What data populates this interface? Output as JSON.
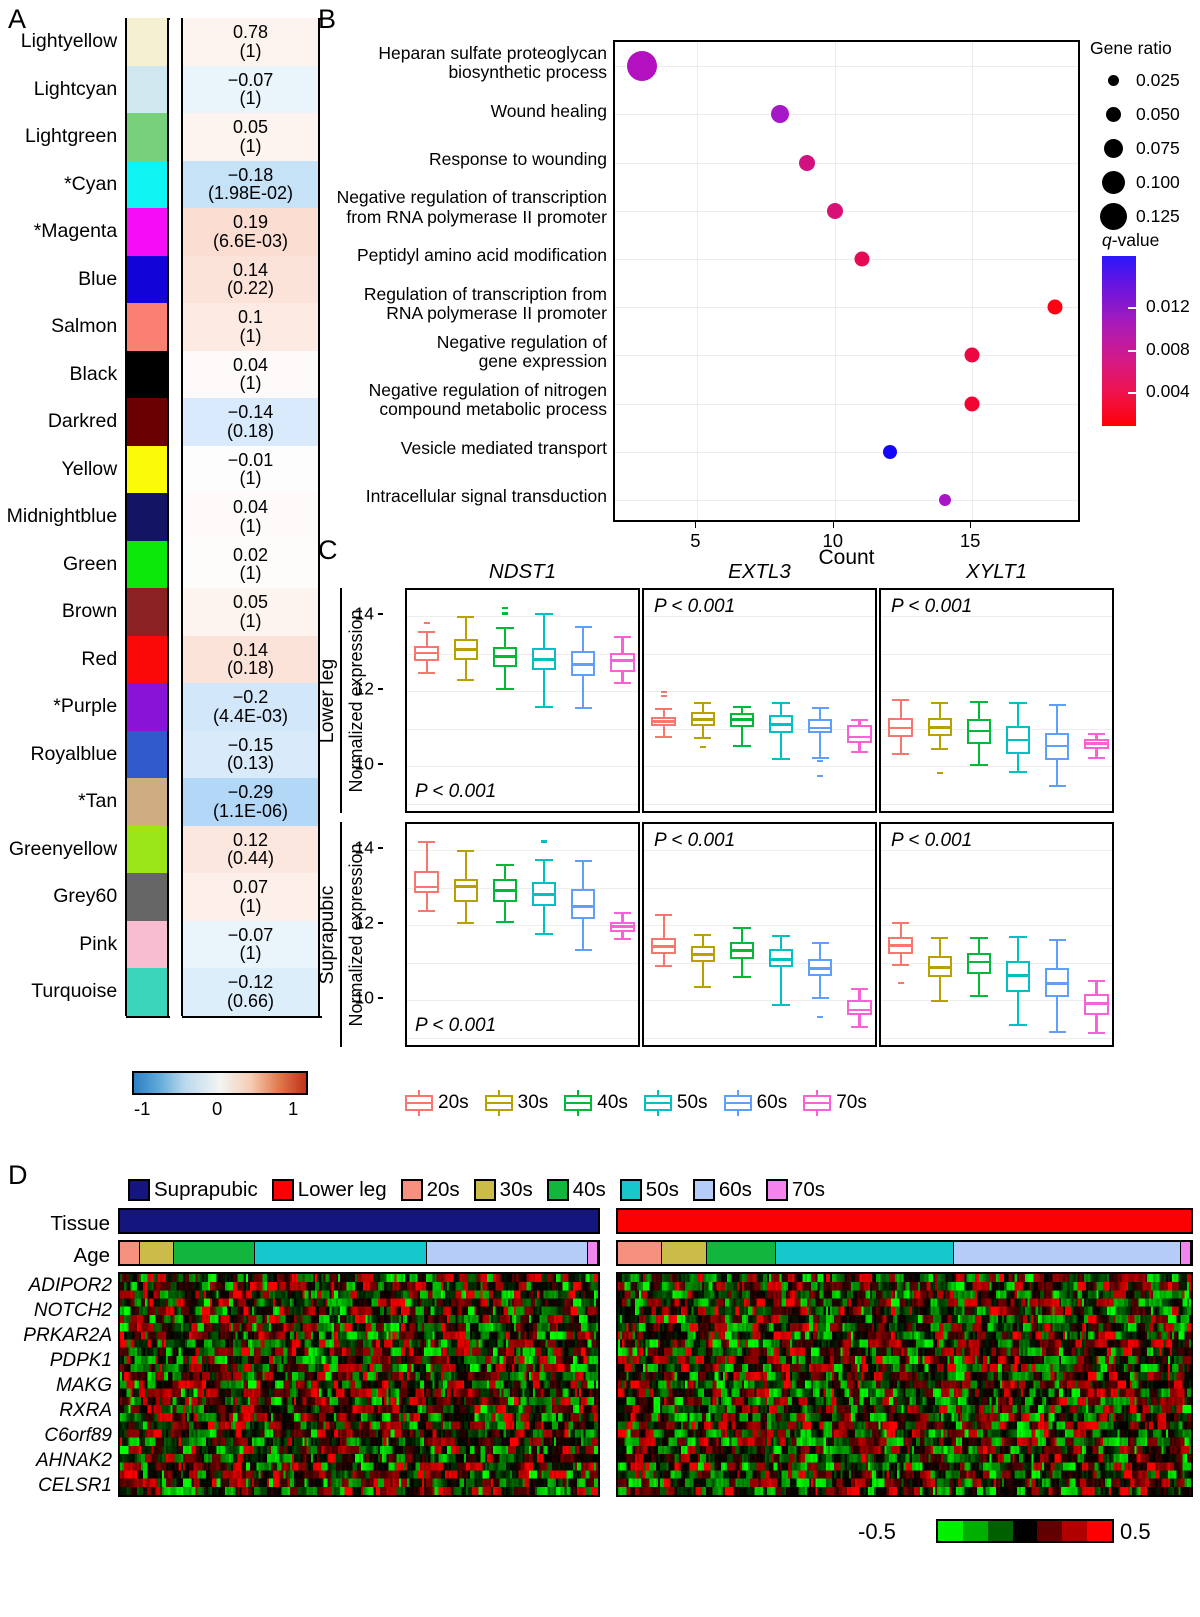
{
  "panels": {
    "A": {
      "letter": "A"
    },
    "B": {
      "letter": "B"
    },
    "C": {
      "letter": "C"
    },
    "D": {
      "letter": "D"
    }
  },
  "panelA": {
    "scale": {
      "min": "-1",
      "mid": "0",
      "max": "1"
    },
    "rows": [
      {
        "name": "Lightyellow",
        "color": "#f5f0d2",
        "corr": "0.78",
        "p": "(1)",
        "cell": "#fdf3ee"
      },
      {
        "name": "Lightcyan",
        "color": "#cfe8f0",
        "corr": "−0.07",
        "p": "(1)",
        "cell": "#eaf4fb"
      },
      {
        "name": "Lightgreen",
        "color": "#77d17a",
        "corr": "0.05",
        "p": "(1)",
        "cell": "#fdf4ef"
      },
      {
        "name": "*Cyan",
        "color": "#10f3f3",
        "corr": "−0.18",
        "p": "(1.98E-02)",
        "cell": "#c6e2f7"
      },
      {
        "name": "*Magenta",
        "color": "#f50ef5",
        "corr": "0.19",
        "p": "(6.6E-03)",
        "cell": "#fbddd2"
      },
      {
        "name": "Blue",
        "color": "#1204d8",
        "corr": "0.14",
        "p": "(0.22)",
        "cell": "#fce3da"
      },
      {
        "name": "Salmon",
        "color": "#fa8072",
        "corr": "0.1",
        "p": "(1)",
        "cell": "#fdeae3"
      },
      {
        "name": "Black",
        "color": "#000000",
        "corr": "0.04",
        "p": "(1)",
        "cell": "#fefafa"
      },
      {
        "name": "Darkred",
        "color": "#6b0000",
        "corr": "−0.14",
        "p": "(0.18)",
        "cell": "#d8eafb"
      },
      {
        "name": "Yellow",
        "color": "#fbfb09",
        "corr": "−0.01",
        "p": "(1)",
        "cell": "#fdfdfd"
      },
      {
        "name": "Midnightblue",
        "color": "#141464",
        "corr": "0.04",
        "p": "(1)",
        "cell": "#fefafa"
      },
      {
        "name": "Green",
        "color": "#09e809",
        "corr": "0.02",
        "p": "(1)",
        "cell": "#fefcfb"
      },
      {
        "name": "Brown",
        "color": "#8b2121",
        "corr": "0.05",
        "p": "(1)",
        "cell": "#fdf4ef"
      },
      {
        "name": "Red",
        "color": "#fb0808",
        "corr": "0.14",
        "p": "(0.18)",
        "cell": "#fce3da"
      },
      {
        "name": "*Purple",
        "color": "#8a13d8",
        "corr": "−0.2",
        "p": "(4.4E-03)",
        "cell": "#d3e7fa"
      },
      {
        "name": "Royalblue",
        "color": "#3059cb",
        "corr": "−0.15",
        "p": "(0.13)",
        "cell": "#d9ebfb"
      },
      {
        "name": "*Tan",
        "color": "#cfad80",
        "corr": "−0.29",
        "p": "(1.1E-06)",
        "cell": "#b3d7f6"
      },
      {
        "name": "Greenyellow",
        "color": "#9ae619",
        "corr": "0.12",
        "p": "(0.44)",
        "cell": "#fce7df"
      },
      {
        "name": "Grey60",
        "color": "#666666",
        "corr": "0.07",
        "p": "(1)",
        "cell": "#fdf0ea"
      },
      {
        "name": "Pink",
        "color": "#f9bdd2",
        "corr": "−0.07",
        "p": "(1)",
        "cell": "#eaf4fb"
      },
      {
        "name": "Turquoise",
        "color": "#3bd5bb",
        "corr": "−0.12",
        "p": "(0.66)",
        "cell": "#ddeefb"
      }
    ]
  },
  "chart_data": [
    {
      "type": "scatter",
      "panel": "B",
      "title": "",
      "xlabel": "Count",
      "ylabel": "",
      "xlim": [
        2,
        19
      ],
      "xticks": [
        5,
        10,
        15
      ],
      "xtick_labels": [
        "5",
        "10",
        "15"
      ],
      "grid": true,
      "legend_position": "right",
      "size_legend": {
        "title": "Gene ratio",
        "values": [
          "0.025",
          "0.050",
          "0.075",
          "0.100",
          "0.125"
        ]
      },
      "color_legend": {
        "title": "q-value",
        "ticks": [
          "0.012",
          "0.008",
          "0.004"
        ],
        "low_color": "#fe0008",
        "high_color": "#2b16fb"
      },
      "categories": [
        "Heparan sulfate proteoglycan biosynthetic process",
        "Wound healing",
        "Response to wounding",
        "Negative regulation of transcription from RNA polymerase II promoter",
        "Peptidyl amino acid modification",
        "Regulation of transcription from RNA polymerase II promoter",
        "Negative regulation of gene expression",
        "Negative regulation of nitrogen compound metabolic process",
        "Vesicle mediated transport",
        "Intracellular signal transduction"
      ],
      "points": [
        {
          "label": "Heparan sulfate proteoglycan biosynthetic process",
          "count": 3,
          "gene_ratio": 0.125,
          "q": 0.0095,
          "color": "#b311c0",
          "size": 30
        },
        {
          "label": "Wound healing",
          "count": 8,
          "gene_ratio": 0.048,
          "q": 0.009,
          "color": "#a617c9",
          "size": 18
        },
        {
          "label": "Response to wounding",
          "count": 9,
          "gene_ratio": 0.04,
          "q": 0.0062,
          "color": "#d1117f",
          "size": 16
        },
        {
          "label": "Negative regulation of transcription from RNA polymerase II promoter",
          "count": 10,
          "gene_ratio": 0.04,
          "q": 0.0058,
          "color": "#d80f74",
          "size": 16
        },
        {
          "label": "Peptidyl amino acid modification",
          "count": 11,
          "gene_ratio": 0.038,
          "q": 0.0045,
          "color": "#e60a53",
          "size": 15
        },
        {
          "label": "Regulation of transcription from RNA polymerase II promoter",
          "count": 18,
          "gene_ratio": 0.036,
          "q": 0.002,
          "color": "#fd0210",
          "size": 15
        },
        {
          "label": "Negative regulation of gene expression",
          "count": 15,
          "gene_ratio": 0.036,
          "q": 0.0038,
          "color": "#ec0741",
          "size": 15
        },
        {
          "label": "Negative regulation of nitrogen compound metabolic process",
          "count": 15,
          "gene_ratio": 0.036,
          "q": 0.0032,
          "color": "#f20531",
          "size": 15
        },
        {
          "label": "Vesicle mediated transport",
          "count": 12,
          "gene_ratio": 0.032,
          "q": 0.015,
          "color": "#1606f7",
          "size": 14
        },
        {
          "label": "Intracellular signal transduction",
          "count": 14,
          "gene_ratio": 0.028,
          "q": 0.0105,
          "color": "#a915c6",
          "size": 12
        }
      ]
    },
    {
      "type": "box",
      "panel": "C",
      "ylabel": "Normalized expression",
      "ylim": [
        8.7,
        14.7
      ],
      "yticks": [
        10,
        12,
        14
      ],
      "ytick_labels": [
        "10",
        "12",
        "14"
      ],
      "genes": [
        "NDST1",
        "EXTL3",
        "XYLT1"
      ],
      "tissues": [
        "Lower leg",
        "Suprapubic"
      ],
      "groups": [
        "20s",
        "30s",
        "40s",
        "50s",
        "60s",
        "70s"
      ],
      "group_colors": [
        "#f7766d",
        "#b8a000",
        "#00b939",
        "#00c1c1",
        "#5f9efa",
        "#fb61d7"
      ],
      "p_values": {
        "Lower leg": {
          "NDST1": "P < 0.001",
          "EXTL3": "P < 0.001",
          "XYLT1": "P < 0.001"
        },
        "Suprapubic": {
          "NDST1": "P < 0.001",
          "EXTL3": "P < 0.001",
          "XYLT1": "P < 0.001"
        }
      },
      "boxes": {
        "Lower leg": {
          "NDST1": [
            {
              "group": "20s",
              "low": 12.52,
              "q1": 12.82,
              "med": 13.02,
              "q3": 13.22,
              "high": 13.62,
              "outliers": [
                13.82
              ]
            },
            {
              "group": "30s",
              "low": 12.32,
              "q1": 12.84,
              "med": 13.12,
              "q3": 13.4,
              "high": 14.0,
              "outliers": []
            },
            {
              "group": "40s",
              "low": 12.1,
              "q1": 12.66,
              "med": 12.92,
              "q3": 13.18,
              "high": 13.72,
              "outliers": [
                14.08,
                14.22
              ]
            },
            {
              "group": "50s",
              "low": 11.62,
              "q1": 12.56,
              "med": 12.84,
              "q3": 13.16,
              "high": 14.08,
              "outliers": []
            },
            {
              "group": "60s",
              "low": 11.58,
              "q1": 12.4,
              "med": 12.72,
              "q3": 13.08,
              "high": 13.74,
              "outliers": []
            },
            {
              "group": "70s",
              "low": 12.24,
              "q1": 12.52,
              "med": 12.82,
              "q3": 13.02,
              "high": 13.48,
              "outliers": []
            }
          ],
          "EXTL3": [
            {
              "group": "20s",
              "low": 10.82,
              "q1": 11.08,
              "med": 11.2,
              "q3": 11.32,
              "high": 11.56,
              "outliers": [
                11.88,
                11.98
              ]
            },
            {
              "group": "30s",
              "low": 10.78,
              "q1": 11.08,
              "med": 11.24,
              "q3": 11.46,
              "high": 11.72,
              "outliers": [
                10.52
              ]
            },
            {
              "group": "40s",
              "low": 10.56,
              "q1": 11.04,
              "med": 11.24,
              "q3": 11.42,
              "high": 11.62,
              "outliers": []
            },
            {
              "group": "50s",
              "low": 10.22,
              "q1": 10.9,
              "med": 11.12,
              "q3": 11.36,
              "high": 11.72,
              "outliers": []
            },
            {
              "group": "60s",
              "low": 10.26,
              "q1": 10.88,
              "med": 11.02,
              "q3": 11.26,
              "high": 11.58,
              "outliers": [
                10.14,
                9.74
              ]
            },
            {
              "group": "70s",
              "low": 10.4,
              "q1": 10.62,
              "med": 10.78,
              "q3": 11.1,
              "high": 11.26,
              "outliers": []
            }
          ],
          "XYLT1": [
            {
              "group": "20s",
              "low": 10.36,
              "q1": 10.78,
              "med": 11.02,
              "q3": 11.3,
              "high": 11.8,
              "outliers": []
            },
            {
              "group": "30s",
              "low": 10.48,
              "q1": 10.8,
              "med": 11.04,
              "q3": 11.3,
              "high": 11.72,
              "outliers": [
                9.82
              ]
            },
            {
              "group": "40s",
              "low": 10.06,
              "q1": 10.6,
              "med": 10.94,
              "q3": 11.26,
              "high": 11.74,
              "outliers": []
            },
            {
              "group": "50s",
              "low": 9.88,
              "q1": 10.34,
              "med": 10.7,
              "q3": 11.08,
              "high": 11.72,
              "outliers": []
            },
            {
              "group": "60s",
              "low": 9.5,
              "q1": 10.18,
              "med": 10.54,
              "q3": 10.9,
              "high": 11.66,
              "outliers": []
            },
            {
              "group": "70s",
              "low": 10.26,
              "q1": 10.46,
              "med": 10.6,
              "q3": 10.74,
              "high": 10.9,
              "outliers": []
            }
          ]
        },
        "Suprapubic": {
          "NDST1": [
            {
              "group": "20s",
              "low": 12.4,
              "q1": 12.86,
              "med": 13.02,
              "q3": 13.44,
              "high": 14.26,
              "outliers": []
            },
            {
              "group": "30s",
              "low": 12.08,
              "q1": 12.62,
              "med": 13.04,
              "q3": 13.24,
              "high": 14.0,
              "outliers": []
            },
            {
              "group": "40s",
              "low": 12.12,
              "q1": 12.62,
              "med": 12.92,
              "q3": 13.24,
              "high": 13.64,
              "outliers": []
            },
            {
              "group": "50s",
              "low": 11.8,
              "q1": 12.52,
              "med": 12.82,
              "q3": 13.16,
              "high": 13.76,
              "outliers": [
                14.24
              ]
            },
            {
              "group": "60s",
              "low": 11.36,
              "q1": 12.18,
              "med": 12.5,
              "q3": 12.96,
              "high": 13.74,
              "outliers": []
            },
            {
              "group": "70s",
              "low": 11.66,
              "q1": 11.82,
              "med": 11.96,
              "q3": 12.08,
              "high": 12.36,
              "outliers": []
            }
          ],
          "EXTL3": [
            {
              "group": "20s",
              "low": 10.94,
              "q1": 11.24,
              "med": 11.44,
              "q3": 11.66,
              "high": 12.3,
              "outliers": []
            },
            {
              "group": "30s",
              "low": 10.38,
              "q1": 11.02,
              "med": 11.22,
              "q3": 11.44,
              "high": 11.78,
              "outliers": []
            },
            {
              "group": "40s",
              "low": 10.64,
              "q1": 11.1,
              "med": 11.32,
              "q3": 11.56,
              "high": 11.96,
              "outliers": []
            },
            {
              "group": "50s",
              "low": 9.9,
              "q1": 10.88,
              "med": 11.08,
              "q3": 11.36,
              "high": 11.74,
              "outliers": []
            },
            {
              "group": "60s",
              "low": 10.1,
              "q1": 10.64,
              "med": 10.84,
              "q3": 11.1,
              "high": 11.56,
              "outliers": [
                9.56
              ]
            },
            {
              "group": "70s",
              "low": 9.32,
              "q1": 9.62,
              "med": 9.74,
              "q3": 10.02,
              "high": 10.32,
              "outliers": []
            }
          ],
          "XYLT1": [
            {
              "group": "20s",
              "low": 10.96,
              "q1": 11.24,
              "med": 11.46,
              "q3": 11.7,
              "high": 12.1,
              "outliers": [
                10.46
              ]
            },
            {
              "group": "30s",
              "low": 10.02,
              "q1": 10.62,
              "med": 10.88,
              "q3": 11.18,
              "high": 11.7,
              "outliers": []
            },
            {
              "group": "40s",
              "low": 10.14,
              "q1": 10.7,
              "med": 11.02,
              "q3": 11.26,
              "high": 11.7,
              "outliers": []
            },
            {
              "group": "50s",
              "low": 9.36,
              "q1": 10.22,
              "med": 10.66,
              "q3": 11.04,
              "high": 11.72,
              "outliers": []
            },
            {
              "group": "60s",
              "low": 9.18,
              "q1": 10.1,
              "med": 10.44,
              "q3": 10.86,
              "high": 11.64,
              "outliers": []
            },
            {
              "group": "70s",
              "low": 9.16,
              "q1": 9.62,
              "med": 9.92,
              "q3": 10.18,
              "high": 10.54,
              "outliers": []
            }
          ]
        }
      }
    },
    {
      "type": "heatmap",
      "panel": "D",
      "row_label_tissue": "Tissue",
      "row_label_age": "Age",
      "genes": [
        "ADIPOR2",
        "NOTCH2",
        "PRKAR2A",
        "PDPK1",
        "MAKG",
        "RXRA",
        "C6orf89",
        "AHNAK2",
        "CELSR1"
      ],
      "legend": [
        {
          "label": "Suprapubic",
          "color": "#151580"
        },
        {
          "label": "Lower leg",
          "color": "#fb0000"
        },
        {
          "label": "20s",
          "color": "#f7917f"
        },
        {
          "label": "30s",
          "color": "#cbbc4a"
        },
        {
          "label": "40s",
          "color": "#12b63c"
        },
        {
          "label": "50s",
          "color": "#16c8cc"
        },
        {
          "label": "60s",
          "color": "#b6ccf8"
        },
        {
          "label": "70s",
          "color": "#f383ed"
        }
      ],
      "scale": {
        "min": "-0.5",
        "max": "0.5",
        "colors": [
          "#00ff00",
          "#008000",
          "#000000",
          "#800000",
          "#ff0000"
        ]
      },
      "tissue_blocks": [
        {
          "label": "Suprapubic",
          "color": "#151580",
          "frac": 0.455
        },
        {
          "label": "Lower leg",
          "color": "#fb0000",
          "frac": 0.545
        }
      ],
      "age_blocks_left": [
        {
          "label": "20s",
          "color": "#f7917f",
          "frac": 0.042
        },
        {
          "label": "30s",
          "color": "#cbbc4a",
          "frac": 0.072
        },
        {
          "label": "40s",
          "color": "#12b63c",
          "frac": 0.168
        },
        {
          "label": "50s",
          "color": "#16c8cc",
          "frac": 0.36
        },
        {
          "label": "60s",
          "color": "#b6ccf8",
          "frac": 0.338
        },
        {
          "label": "70s",
          "color": "#f383ed",
          "frac": 0.02
        }
      ],
      "age_blocks_right": [
        {
          "label": "20s",
          "color": "#f7917f",
          "frac": 0.077
        },
        {
          "label": "30s",
          "color": "#cbbc4a",
          "frac": 0.078
        },
        {
          "label": "40s",
          "color": "#12b63c",
          "frac": 0.121
        },
        {
          "label": "50s",
          "color": "#16c8cc",
          "frac": 0.31
        },
        {
          "label": "60s",
          "color": "#b6ccf8",
          "frac": 0.396
        },
        {
          "label": "70s",
          "color": "#f383ed",
          "frac": 0.018
        }
      ]
    }
  ]
}
